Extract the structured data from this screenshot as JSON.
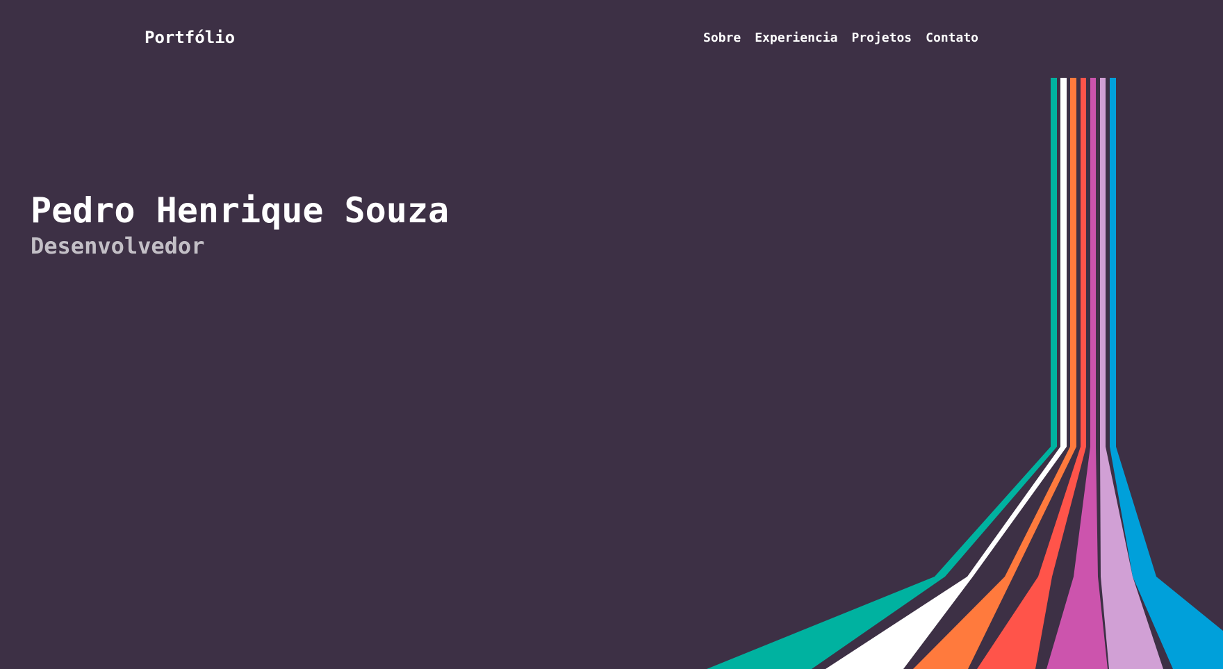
{
  "header": {
    "brand": "Portfólio",
    "nav": [
      "Sobre",
      "Experiencia",
      "Projetos",
      "Contato"
    ]
  },
  "hero": {
    "name": "Pedro Henrique Souza",
    "role": "Desenvolvedor"
  },
  "colors": {
    "background": "#3d3045",
    "text": "#ffffff",
    "role_text": "#c3bfc6",
    "stripes": [
      "#00b2a0",
      "#ffffff",
      "#ff7a3d",
      "#ff544a",
      "#cc54ad",
      "#d1a0d5",
      "#00a0da"
    ]
  }
}
